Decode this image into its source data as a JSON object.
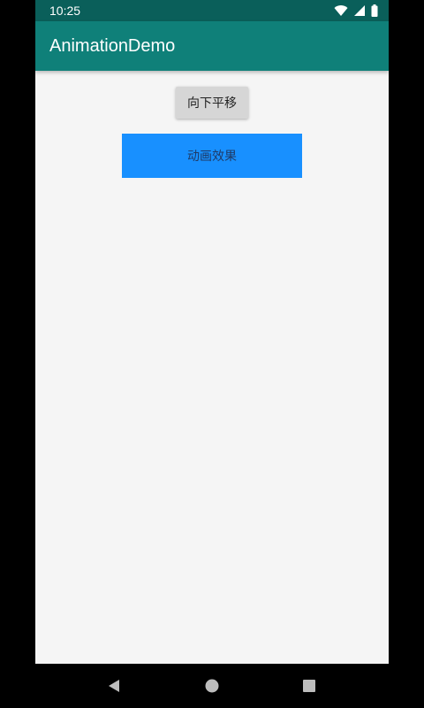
{
  "status_bar": {
    "time": "10:25",
    "icons": [
      "wifi-icon",
      "signal-icon",
      "battery-icon"
    ]
  },
  "app_bar": {
    "title": "AnimationDemo",
    "color": "#0f8079"
  },
  "content": {
    "button_label": "向下平移",
    "animated_view_label": "动画效果",
    "animated_view_color": "#1890ff"
  },
  "nav_bar": {
    "icons": [
      "back-icon",
      "home-icon",
      "recents-icon"
    ]
  }
}
